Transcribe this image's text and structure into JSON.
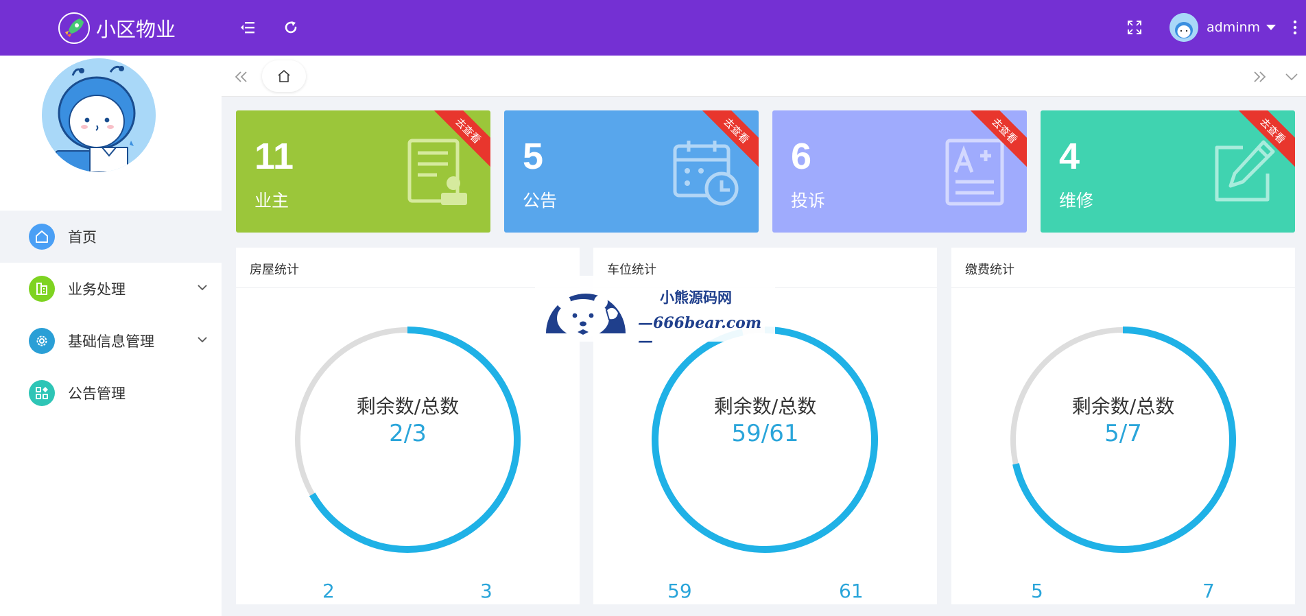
{
  "header": {
    "app_title": "小区物业",
    "username": "adminm"
  },
  "tabs": {
    "home_icon": "home-icon"
  },
  "sidebar": {
    "items": [
      {
        "label": "首页",
        "icon": "home-icon",
        "color": "#4a9ff5",
        "active": true
      },
      {
        "label": "业务处理",
        "icon": "building-icon",
        "color": "#7ed321",
        "expandable": true
      },
      {
        "label": "基础信息管理",
        "icon": "gear-icon",
        "color": "#2a9fd6",
        "expandable": true
      },
      {
        "label": "公告管理",
        "icon": "apps-icon",
        "color": "#2ec5b6"
      }
    ]
  },
  "cards": [
    {
      "number": "11",
      "label": "业主",
      "ribbon": "去查看",
      "color": "#9bc63a",
      "icon": "document-user-icon"
    },
    {
      "number": "5",
      "label": "公告",
      "ribbon": "去查看",
      "color": "#58a6ec",
      "icon": "calendar-clock-icon"
    },
    {
      "number": "6",
      "label": "投诉",
      "ribbon": "去查看",
      "color": "#9fabfd",
      "icon": "grade-sheet-icon"
    },
    {
      "number": "4",
      "label": "维修",
      "ribbon": "去查看",
      "color": "#40d3b0",
      "icon": "edit-icon"
    }
  ],
  "panels": [
    {
      "title": "房屋统计",
      "label": "剩余数/总数",
      "value": "2/3",
      "remaining": 2,
      "total": 3,
      "min_label": "2",
      "max_label": "3"
    },
    {
      "title": "车位统计",
      "label": "剩余数/总数",
      "value": "59/61",
      "remaining": 59,
      "total": 61,
      "min_label": "59",
      "max_label": "61"
    },
    {
      "title": "缴费统计",
      "label": "剩余数/总数",
      "value": "5/7",
      "remaining": 5,
      "total": 7,
      "min_label": "5",
      "max_label": "7"
    }
  ],
  "watermark": {
    "line1": "小熊源码网",
    "line2": "—666bear.com—"
  },
  "colors": {
    "header_bg": "#7430d3",
    "gauge_fill": "#1fb1e6",
    "gauge_track": "#dddddd",
    "ribbon": "#e8362d"
  }
}
